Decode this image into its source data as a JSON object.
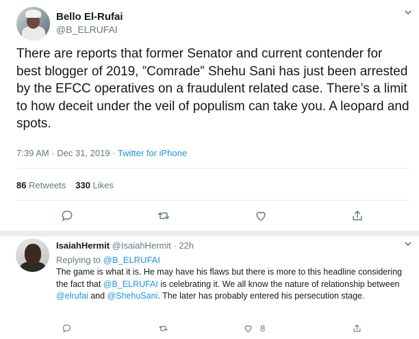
{
  "tweet": {
    "author_name": "Bello El-Rufai",
    "author_handle": "@B_ELRUFAI",
    "text": "There are reports that former Senator and current contender for best blogger of 2019, ”Comrade” Shehu Sani has just been arrested by the EFCC operatives on a fraudulent related case. There’s a limit to how deceit under the veil of populism can take you. A leopard and spots.",
    "time": "7:39 AM",
    "date": "Dec 31, 2019",
    "separator": " · ",
    "source": "Twitter for iPhone",
    "retweets_count": "86",
    "retweets_label": "Retweets",
    "likes_count": "330",
    "likes_label": "Likes"
  },
  "reply": {
    "author_name": "IsaiahHermit",
    "author_handle": "@IsaiahHermit",
    "time_ago": "22h",
    "separator": " · ",
    "replying_label": "Replying to",
    "replying_to": "@B_ELRUFAI",
    "text_1": "The game is what it is. He may have his flaws but there is more to this headline considering the fact that ",
    "mention_1": "@B_ELRUFAI",
    "text_2": " is celebrating it. We all know the nature of relationship between ",
    "mention_2": "@elrufai",
    "text_3": " and ",
    "mention_3": "@ShehuSani",
    "text_4": ". The later has probably entered his persecution stage.",
    "likes_count": "8"
  },
  "colors": {
    "link": "#1b95e0",
    "secondary_text": "#657786",
    "divider": "#e6ecf0",
    "primary_text": "#14171a"
  },
  "icons": {
    "reply": "reply-icon",
    "retweet": "retweet-icon",
    "like": "heart-icon",
    "share": "share-icon",
    "more": "chevron-down-icon"
  }
}
